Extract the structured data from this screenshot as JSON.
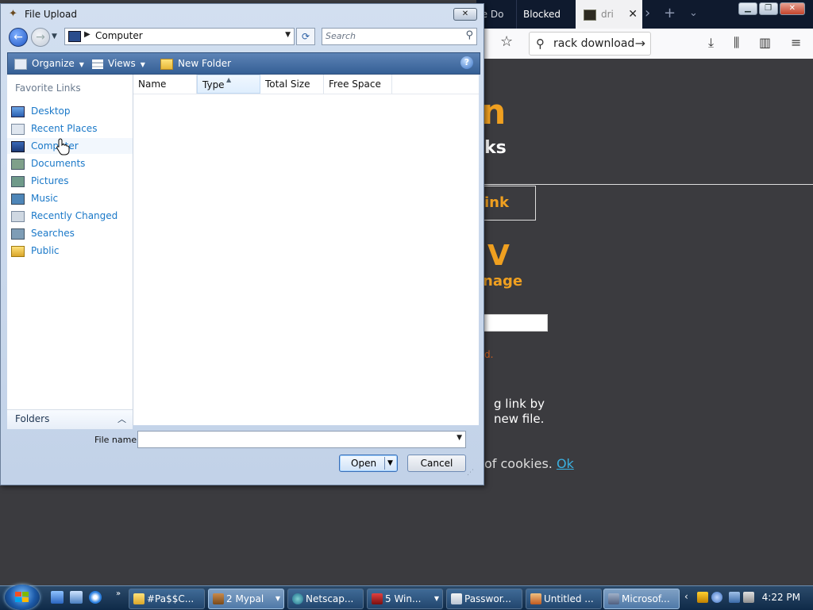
{
  "browser": {
    "tabs": [
      {
        "label": "re Do"
      },
      {
        "label": "Blocked"
      },
      {
        "label": "dri"
      }
    ],
    "url_text": "rack download",
    "page": {
      "big_letter": "n",
      "ks_text": "ks",
      "link_text": "ink",
      "v_text": "V",
      "image_text": "nage",
      "red_text": "d.",
      "paragraph_line1": "g link by",
      "paragraph_line2": "new file.",
      "cookies_text": "of cookies.",
      "ok_text": "Ok"
    }
  },
  "dialog": {
    "title": "File Upload",
    "address": "Computer",
    "search_placeholder": "Search",
    "toolbar": {
      "organize": "Organize",
      "views": "Views",
      "new_folder": "New Folder"
    },
    "nav": {
      "header": "Favorite Links",
      "items": [
        {
          "label": "Desktop"
        },
        {
          "label": "Recent Places"
        },
        {
          "label": "Computer"
        },
        {
          "label": "Documents"
        },
        {
          "label": "Pictures"
        },
        {
          "label": "Music"
        },
        {
          "label": "Recently Changed"
        },
        {
          "label": "Searches"
        },
        {
          "label": "Public"
        }
      ],
      "folders_label": "Folders"
    },
    "columns": [
      {
        "label": "Name"
      },
      {
        "label": "Type"
      },
      {
        "label": "Total Size"
      },
      {
        "label": "Free Space"
      }
    ],
    "file_name_label": "File name:",
    "file_name_value": "",
    "open_label": "Open",
    "cancel_label": "Cancel"
  },
  "taskbar": {
    "tasks": [
      {
        "label": "#Pa$$C..."
      },
      {
        "label": "2 Mypal"
      },
      {
        "label": "Netscap..."
      },
      {
        "label": "5 Win..."
      },
      {
        "label": "Passwor..."
      },
      {
        "label": "Untitled ..."
      },
      {
        "label": "Microsof..."
      }
    ],
    "clock": "4:22 PM"
  },
  "colors": {
    "accent_orange": "#f0a020",
    "link_blue": "#1a78c8",
    "dialog_toolbar": "#3f6a9e"
  }
}
